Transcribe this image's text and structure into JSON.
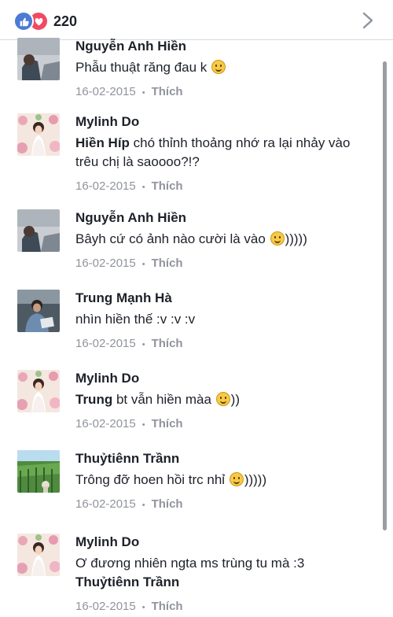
{
  "reactions": {
    "count": "220"
  },
  "comments": [
    {
      "author": "Nguyễn Anh Hiền",
      "text": "Phẫu thuật răng đau k",
      "date": "16-02-2015",
      "like": "Thích",
      "avatar": "portrait"
    },
    {
      "author": "Mylinh Do",
      "mention": "Hiền Híp",
      "text": " chó thỉnh thoảng nhớ ra lại nhảy vào trêu chị là saoooo?!?",
      "date": "16-02-2015",
      "like": "Thích",
      "avatar": "flowers"
    },
    {
      "author": "Nguyễn Anh Hiền",
      "text": "Bâyh cứ có ảnh nào cười là vào",
      "text_suffix": ")))))",
      "date": "16-02-2015",
      "like": "Thích",
      "avatar": "portrait"
    },
    {
      "author": "Trung Mạnh Hà",
      "text": "nhìn hiền thế :v :v :v",
      "date": "16-02-2015",
      "like": "Thích",
      "avatar": "man"
    },
    {
      "author": "Mylinh Do",
      "mention": "Trung",
      "text": " bt vẫn hiền màa",
      "text_suffix": "))",
      "date": "16-02-2015",
      "like": "Thích",
      "avatar": "flowers"
    },
    {
      "author": "Thuỷtiênn Trầnn",
      "text": "Trông đỡ hoen hồi trc nhỉ",
      "text_suffix": ")))))",
      "date": "16-02-2015",
      "like": "Thích",
      "avatar": "garden"
    },
    {
      "author": "Mylinh Do",
      "text": "Ơ đương nhiên ngta ms trùng tu mà :3",
      "mention_after": "Thuỷtiênn Trầnn",
      "date": "16-02-2015",
      "like": "Thích",
      "avatar": "flowers"
    }
  ]
}
